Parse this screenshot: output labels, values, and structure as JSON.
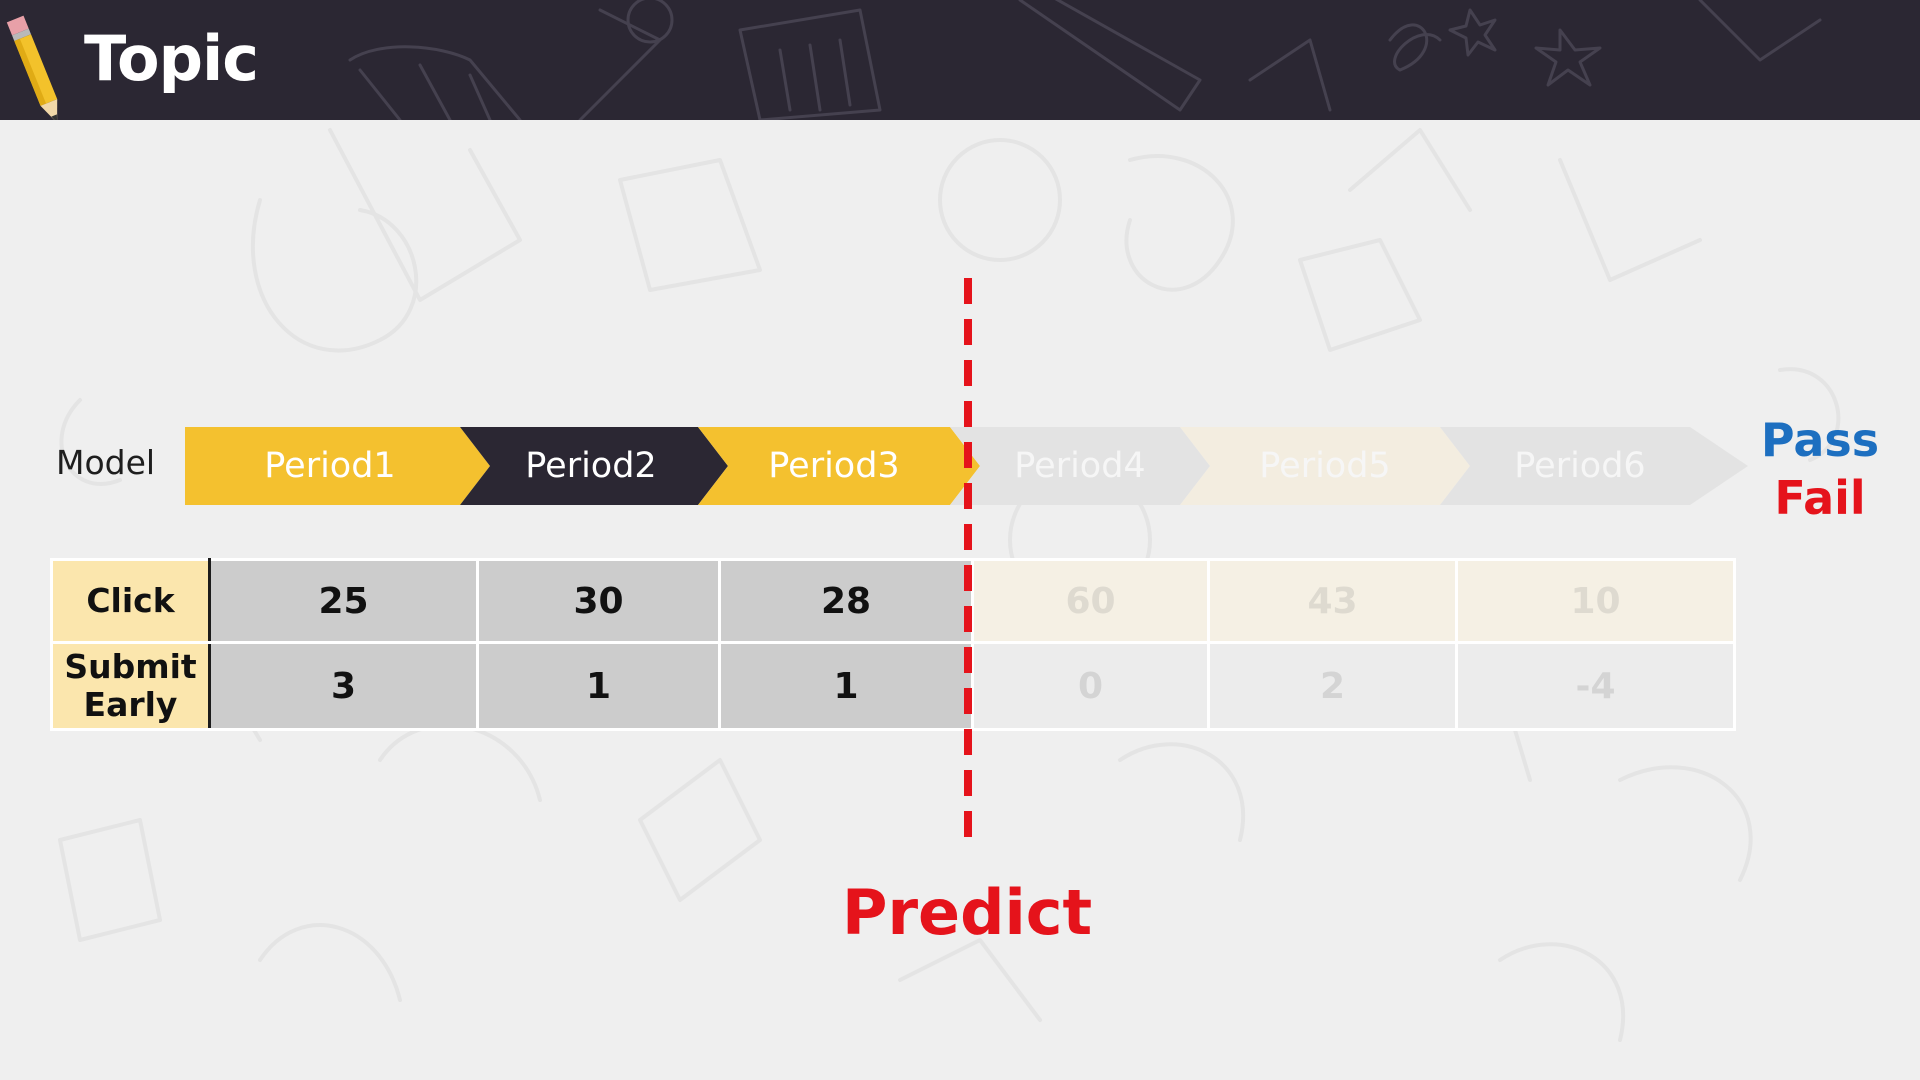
{
  "header": {
    "title": "Topic",
    "icon": "pencil-icon"
  },
  "model": {
    "label": "Model",
    "periods": [
      {
        "label": "Period1",
        "color": "#f4c12f",
        "active": true
      },
      {
        "label": "Period2",
        "color": "#2b2733",
        "active": true
      },
      {
        "label": "Period3",
        "color": "#f4c12f",
        "active": true
      },
      {
        "label": "Period4",
        "color": "#e3e3e3",
        "active": false
      },
      {
        "label": "Period5",
        "color": "#f3ede0",
        "active": false
      },
      {
        "label": "Period6",
        "color": "#e3e3e3",
        "active": false
      }
    ]
  },
  "table": {
    "rows": [
      {
        "header": "Click",
        "values": [
          "25",
          "30",
          "28",
          "60",
          "43",
          "10"
        ]
      },
      {
        "header_line1": "Submit",
        "header_line2": "Early",
        "values": [
          "3",
          "1",
          "1",
          "0",
          "2",
          "-4"
        ]
      }
    ]
  },
  "outcome": {
    "pass": "Pass",
    "fail": "Fail"
  },
  "predict": {
    "label": "Predict",
    "color": "#e5131b"
  }
}
